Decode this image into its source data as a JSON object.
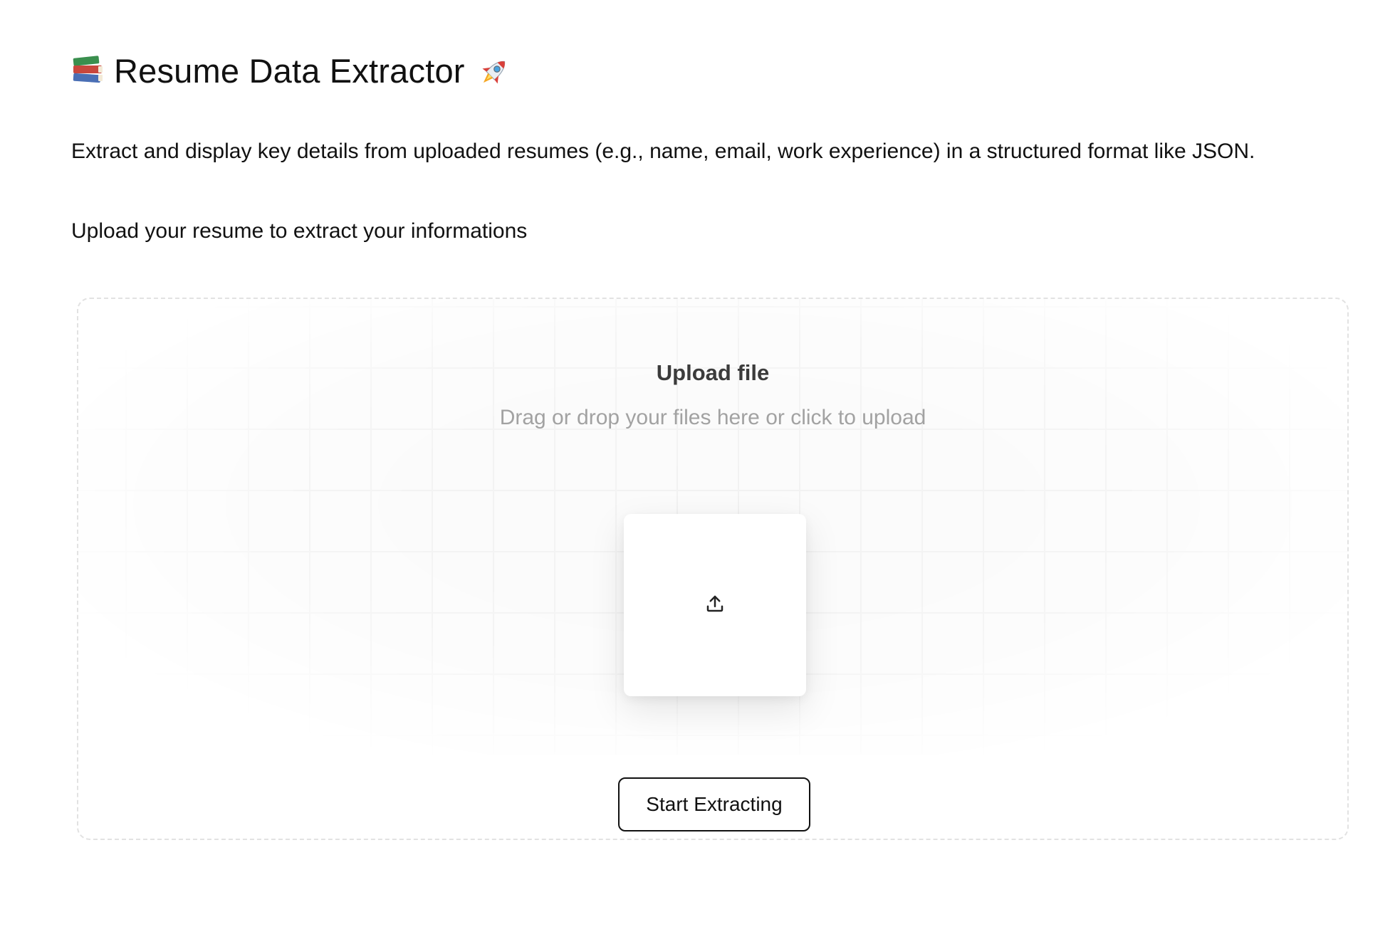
{
  "header": {
    "title": "Resume Data Extractor",
    "leading_icon": "books-icon",
    "trailing_icon": "rocket-icon"
  },
  "description": "Extract and display key details from uploaded resumes (e.g., name, email, work experience) in a structured format like JSON.",
  "subdescription": "Upload your resume to extract your informations",
  "uploader": {
    "title": "Upload file",
    "hint": "Drag or drop your files here or click to upload",
    "icon": "upload-icon",
    "button_label": "Start Extracting"
  }
}
